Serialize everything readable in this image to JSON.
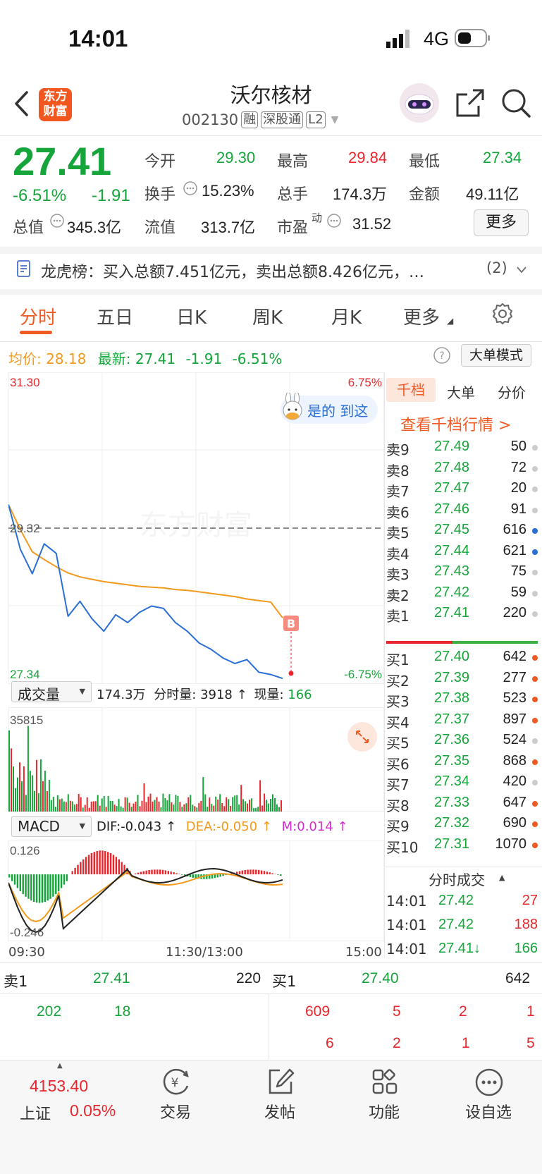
{
  "status": {
    "time": "14:01",
    "network": "4G"
  },
  "header": {
    "logo_line1": "东方",
    "logo_line2": "财富",
    "name": "沃尔核材",
    "code": "002130",
    "tags": [
      "融",
      "深股通",
      "L2"
    ]
  },
  "quote": {
    "price": "27.41",
    "change_pct": "-6.51%",
    "change": "-1.91",
    "open_label": "今开",
    "open": "29.30",
    "high_label": "最高",
    "high": "29.84",
    "low_label": "最低",
    "low": "27.34",
    "turnover_label": "换手",
    "turnover": "15.23%",
    "volume_label": "总手",
    "volume": "174.3万",
    "amount_label": "金额",
    "amount": "49.11亿",
    "mktcap_label": "总值",
    "mktcap": "345.3亿",
    "float_label": "流值",
    "float": "313.7亿",
    "pe_label": "市盈",
    "pe_sup": "动",
    "pe": "31.52",
    "more": "更多"
  },
  "notice": {
    "title": "龙虎榜：",
    "text": "买入总额7.451亿元，卖出总额8.426亿元，…",
    "count": "(2)"
  },
  "tabs": [
    "分时",
    "五日",
    "日K",
    "周K",
    "月K",
    "更多"
  ],
  "intraday": {
    "avg_label": "均价:",
    "avg": "28.18",
    "latest_label": "最新:",
    "latest": "27.41",
    "latest_change": "-1.91",
    "latest_pct": "-6.51%",
    "mode_button": "大单模式",
    "y_top": "31.30",
    "y_mid": "29.32",
    "y_bottom": "27.34",
    "pct_top": "6.75%",
    "pct_bottom": "-6.75%",
    "watermark": "东方财富",
    "mascot_text": "是的 到这",
    "buy_marker": "B",
    "volume_label": "成交量",
    "volume_total": "174.3万",
    "volume_detail_label": "分时量:",
    "volume_detail": "3918",
    "current_label": "现量:",
    "current": "166",
    "volume_max": "35815",
    "macd_label": "MACD",
    "dif": "DIF:-0.043",
    "dea": "DEA:-0.050",
    "m": "M:0.014",
    "macd_top": "0.126",
    "macd_bottom": "-0.246",
    "time_start": "09:30",
    "time_mid": "11:30/13:00",
    "time_end": "15:00"
  },
  "chart_data": {
    "type": "line",
    "ylim": [
      27.34,
      31.3
    ],
    "reference": 29.32,
    "series": [
      {
        "name": "最新",
        "values": [
          29.62,
          29.05,
          28.74,
          29.12,
          29.0,
          28.2,
          28.39,
          28.17,
          28.01,
          28.22,
          28.12,
          28.25,
          28.33,
          28.3,
          28.12,
          28.01,
          27.86,
          27.78,
          27.67,
          27.6,
          27.65,
          27.49,
          27.46,
          27.41
        ]
      },
      {
        "name": "均价",
        "values": [
          29.62,
          29.3,
          29.02,
          28.92,
          28.83,
          28.75,
          28.7,
          28.67,
          28.64,
          28.62,
          28.6,
          28.58,
          28.57,
          28.56,
          28.54,
          28.53,
          28.51,
          28.49,
          28.47,
          28.45,
          28.42,
          28.4,
          28.38,
          28.18
        ]
      }
    ]
  },
  "orderbook": {
    "tabs": [
      "千档",
      "大单",
      "分价"
    ],
    "link": "查看千档行情 >",
    "asks": [
      {
        "label": "卖9",
        "price": "27.49",
        "vol": "50",
        "dot": "#cccccc"
      },
      {
        "label": "卖8",
        "price": "27.48",
        "vol": "72",
        "dot": "#cccccc"
      },
      {
        "label": "卖7",
        "price": "27.47",
        "vol": "20",
        "dot": "#cccccc"
      },
      {
        "label": "卖6",
        "price": "27.46",
        "vol": "91",
        "dot": "#cccccc"
      },
      {
        "label": "卖5",
        "price": "27.45",
        "vol": "616",
        "dot": "#2a6fd6"
      },
      {
        "label": "卖4",
        "price": "27.44",
        "vol": "621",
        "dot": "#2a6fd6"
      },
      {
        "label": "卖3",
        "price": "27.43",
        "vol": "75",
        "dot": "#cccccc"
      },
      {
        "label": "卖2",
        "price": "27.42",
        "vol": "59",
        "dot": "#cccccc"
      },
      {
        "label": "卖1",
        "price": "27.41",
        "vol": "220",
        "dot": "#cccccc"
      }
    ],
    "bids": [
      {
        "label": "买1",
        "price": "27.40",
        "vol": "642",
        "dot": "#f05a24"
      },
      {
        "label": "买2",
        "price": "27.39",
        "vol": "277",
        "dot": "#f05a24"
      },
      {
        "label": "买3",
        "price": "27.38",
        "vol": "523",
        "dot": "#f05a24"
      },
      {
        "label": "买4",
        "price": "27.37",
        "vol": "897",
        "dot": "#f05a24"
      },
      {
        "label": "买5",
        "price": "27.36",
        "vol": "524",
        "dot": "#cccccc"
      },
      {
        "label": "买6",
        "price": "27.35",
        "vol": "868",
        "dot": "#f05a24"
      },
      {
        "label": "买7",
        "price": "27.34",
        "vol": "420",
        "dot": "#cccccc"
      },
      {
        "label": "买8",
        "price": "27.33",
        "vol": "647",
        "dot": "#f05a24"
      },
      {
        "label": "买9",
        "price": "27.32",
        "vol": "690",
        "dot": "#f05a24"
      },
      {
        "label": "买10",
        "price": "27.31",
        "vol": "1070",
        "dot": "#f05a24"
      }
    ],
    "trades_title": "分时成交",
    "trades": [
      {
        "time": "14:01",
        "price": "27.42",
        "vol": "27"
      },
      {
        "time": "14:01",
        "price": "27.42",
        "vol": "188"
      },
      {
        "time": "14:01",
        "price": "27.41↓",
        "vol": "166"
      }
    ]
  },
  "summary": {
    "sell_label": "卖1",
    "sell_price": "27.41",
    "sell_vol": "220",
    "buy_label": "买1",
    "buy_price": "27.40",
    "buy_vol": "642",
    "sell_q1": "202",
    "sell_q2": "18",
    "buy_q": [
      "609",
      "5",
      "2",
      "1"
    ],
    "buy_q2": [
      "6",
      "2",
      "1",
      "5"
    ]
  },
  "bottom_nav": {
    "index_value": "4153.40",
    "index_name": "上证",
    "index_pct": "0.05%",
    "items": [
      "交易",
      "发帖",
      "功能",
      "设自选"
    ]
  }
}
